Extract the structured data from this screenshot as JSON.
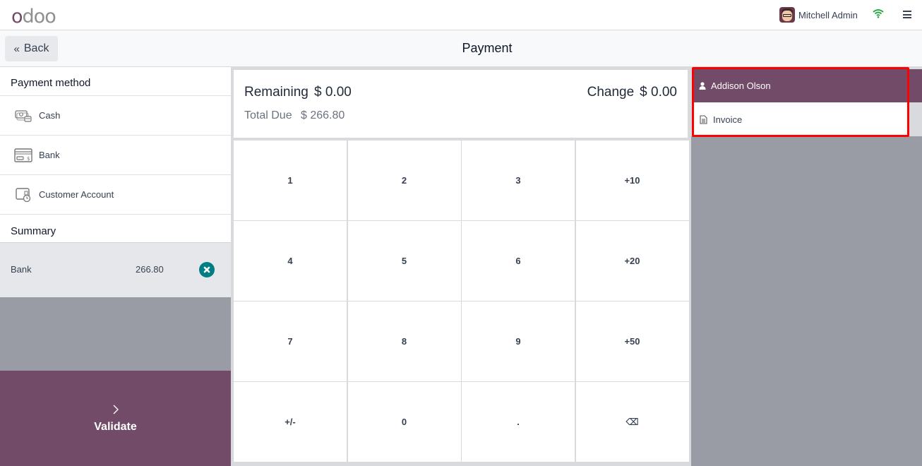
{
  "topbar": {
    "logo_first": "o",
    "logo_rest": "doo",
    "user_name": "Mitchell Admin",
    "icons": [
      "avatar",
      "wifi-icon",
      "hamburger-menu-icon"
    ],
    "wifi_color": "#28a745"
  },
  "subheader": {
    "back_label": "Back",
    "back_icon": "«",
    "title": "Payment"
  },
  "payment_methods": {
    "title": "Payment method",
    "items": [
      {
        "label": "Cash",
        "icon": "cash-icon"
      },
      {
        "label": "Bank",
        "icon": "card-icon"
      },
      {
        "label": "Customer Account",
        "icon": "wallet-clock-icon"
      }
    ]
  },
  "summary": {
    "title": "Summary",
    "lines": [
      {
        "method": "Bank",
        "amount": "266.80"
      }
    ]
  },
  "validate": {
    "label": "Validate"
  },
  "status": {
    "remaining_label": "Remaining",
    "remaining_value": "$ 0.00",
    "total_due_label": "Total Due",
    "total_due_value": "$ 266.80",
    "change_label": "Change",
    "change_value": "$ 0.00"
  },
  "numpad": {
    "keys": [
      "1",
      "2",
      "3",
      "+10",
      "4",
      "5",
      "6",
      "+20",
      "7",
      "8",
      "9",
      "+50",
      "+/-",
      "0",
      ".",
      "⌫"
    ]
  },
  "customer": {
    "name": "Addison Olson",
    "invoice_label": "Invoice"
  },
  "colors": {
    "brand": "#714b67",
    "delete": "#017e84",
    "highlight": "#ff0000"
  }
}
